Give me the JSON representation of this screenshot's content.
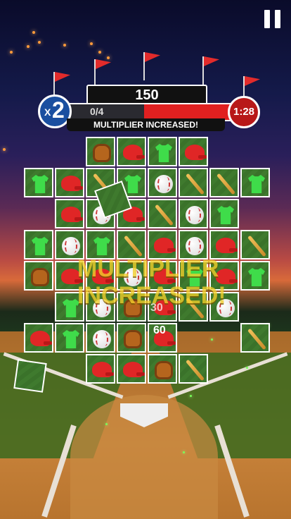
{
  "hud": {
    "score": "150",
    "progress": "0/4",
    "timer": "1:28",
    "multiplier_prefix": "X",
    "multiplier_value": "2",
    "message": "MULTIPLIER INCREASED!"
  },
  "overlay": {
    "line1": "MULTIPLIER",
    "line2": "INCREASED!",
    "points_a": "30",
    "points_b": "60"
  },
  "icons": {
    "shirt": "green-jersey-icon",
    "helmet": "red-helmet-icon",
    "ball": "baseball-icon",
    "bat": "bat-icon",
    "glove": "glove-icon",
    "pause": "pause-icon"
  },
  "colors": {
    "jersey": "#3fdc4a",
    "helmet": "#e02626",
    "timer_bg": "#b81818",
    "multiplier_bg": "#1a4fa0",
    "overlay_text": "#f3d02a"
  },
  "board": [
    [
      "",
      "",
      "glove",
      "helmet",
      "shirt",
      "helmet",
      "",
      ""
    ],
    [
      "shirt",
      "helmet",
      "bat",
      "shirt",
      "ball",
      "bat",
      "bat",
      "shirt"
    ],
    [
      "",
      "helmet",
      "ball",
      "helmet",
      "bat",
      "ball",
      "shirt",
      ""
    ],
    [
      "shirt",
      "ball",
      "shirt",
      "bat",
      "helmet",
      "ball",
      "helmet",
      "bat"
    ],
    [
      "glove",
      "helmet",
      "helmet",
      "ball",
      "helmet",
      "shirt",
      "helmet",
      "shirt"
    ],
    [
      "",
      "shirt",
      "ball",
      "glove",
      "helmet",
      "bat",
      "ball",
      ""
    ],
    [
      "helmet",
      "shirt",
      "ball",
      "glove",
      "helmet",
      "",
      "",
      "bat"
    ],
    [
      "",
      "",
      "helmet",
      "helmet",
      "glove",
      "bat",
      "",
      ""
    ]
  ]
}
